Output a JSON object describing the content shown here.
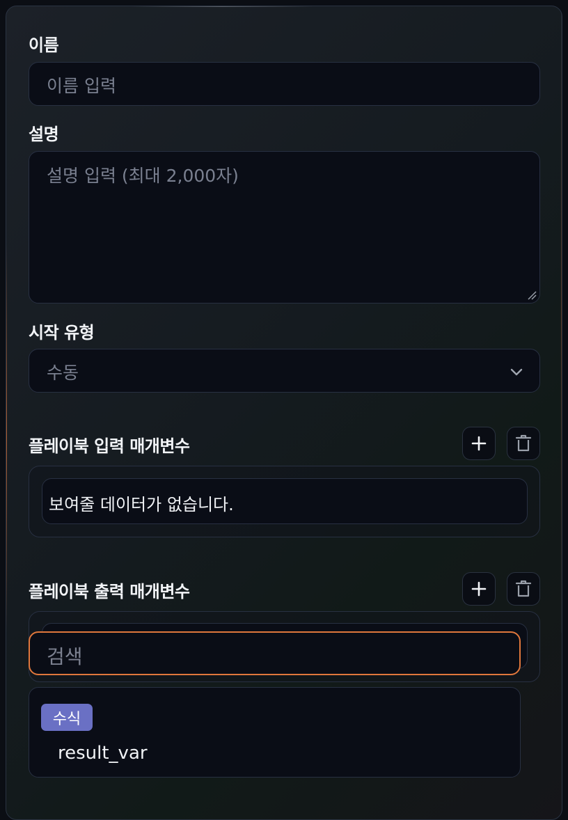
{
  "form": {
    "name": {
      "label": "이름",
      "placeholder": "이름 입력"
    },
    "description": {
      "label": "설명",
      "placeholder": "설명 입력 (최대 2,000자)"
    },
    "start_type": {
      "label": "시작 유형",
      "selected": "수동"
    },
    "input_params": {
      "label": "플레이북 입력 매개변수",
      "empty_text": "보여줄 데이터가 없습니다.",
      "add_icon": "plus-icon",
      "delete_icon": "trash-icon"
    },
    "output_params": {
      "label": "플레이북 출력 매개변수",
      "add_icon": "plus-icon",
      "delete_icon": "trash-icon",
      "search_placeholder": "검색",
      "options": [
        {
          "badge": "수식",
          "value": "result_var"
        }
      ]
    }
  },
  "colors": {
    "accent_focus": "#e0773c",
    "badge": "#6a70c4",
    "field_bg": "#0a0d16"
  }
}
